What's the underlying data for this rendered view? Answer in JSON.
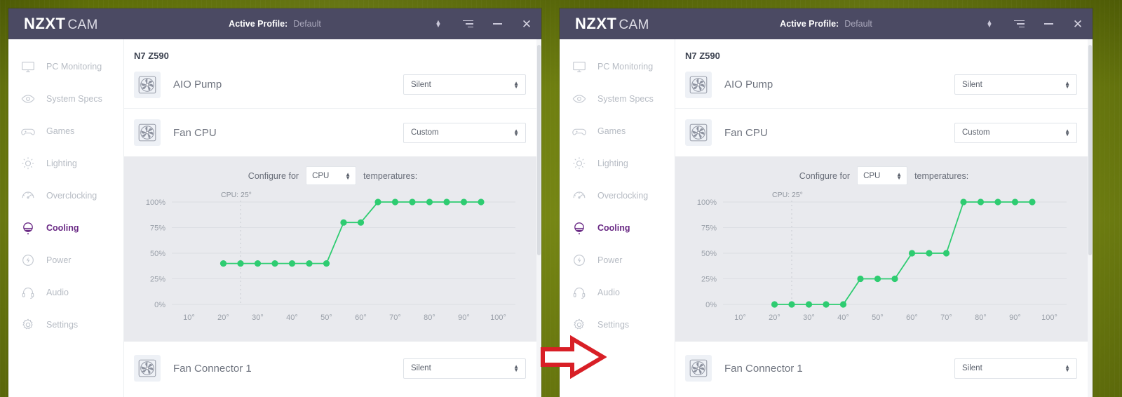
{
  "desktop": {
    "bg": "#76880f"
  },
  "window": {
    "titlebar": {
      "brand_bold": "NZXT",
      "brand_light": "CAM",
      "profile_label": "Active Profile:",
      "profile_value": "Default",
      "controls": [
        {
          "name": "profile-spinner-icon",
          "glyph": "spinner"
        },
        {
          "name": "menu-icon",
          "glyph": "hamburger"
        },
        {
          "name": "minimize-button",
          "glyph": "minimize"
        },
        {
          "name": "close-button",
          "glyph": "close"
        }
      ]
    },
    "sidebar": {
      "items": [
        {
          "label": "PC Monitoring",
          "icon": "monitor-icon",
          "active": false
        },
        {
          "label": "System Specs",
          "icon": "eye-icon",
          "active": false
        },
        {
          "label": "Games",
          "icon": "gamepad-icon",
          "active": false
        },
        {
          "label": "Lighting",
          "icon": "sun-icon",
          "active": false
        },
        {
          "label": "Overclocking",
          "icon": "speedometer-icon",
          "active": false
        },
        {
          "label": "Cooling",
          "icon": "cooling-icon",
          "active": true
        },
        {
          "label": "Power",
          "icon": "power-bolt-icon",
          "active": false
        },
        {
          "label": "Audio",
          "icon": "headset-icon",
          "active": false
        },
        {
          "label": "Settings",
          "icon": "gear-icon",
          "active": false
        }
      ]
    },
    "content": {
      "device_name": "N7 Z590",
      "rows": [
        {
          "label": "AIO Pump",
          "icon": "fan-icon",
          "mode": "Silent"
        },
        {
          "label": "Fan CPU",
          "icon": "fan-icon",
          "mode": "Custom"
        },
        {
          "label": "Fan Connector 1",
          "icon": "fan-icon",
          "mode": "Silent"
        }
      ],
      "configure": {
        "prefix": "Configure for",
        "source": "CPU",
        "suffix": "temperatures:"
      }
    }
  },
  "annotation": {
    "arrow": "right-arrow",
    "color": "#d81f26"
  },
  "chart_data": [
    {
      "type": "line",
      "panel": "left",
      "title": "",
      "xlabel": "",
      "ylabel": "",
      "xlim": [
        5,
        105
      ],
      "ylim": [
        0,
        100
      ],
      "grid": true,
      "legend": null,
      "line_color": "#2ecc71",
      "marker": "circle",
      "current_marker_label": "CPU: 25°",
      "current_temp": 25,
      "xtick_labels": [
        "10°",
        "20°",
        "30°",
        "40°",
        "50°",
        "60°",
        "70°",
        "80°",
        "90°",
        "100°"
      ],
      "xticks": [
        10,
        20,
        30,
        40,
        50,
        60,
        70,
        80,
        90,
        100
      ],
      "ytick_labels": [
        "0%",
        "25%",
        "50%",
        "75%",
        "100%"
      ],
      "yticks": [
        0,
        25,
        50,
        75,
        100
      ],
      "x": [
        20,
        25,
        30,
        35,
        40,
        45,
        50,
        55,
        60,
        65,
        70,
        75,
        80,
        85,
        90,
        95
      ],
      "values": [
        40,
        40,
        40,
        40,
        40,
        40,
        40,
        80,
        80,
        100,
        100,
        100,
        100,
        100,
        100,
        100
      ]
    },
    {
      "type": "line",
      "panel": "right",
      "title": "",
      "xlabel": "",
      "ylabel": "",
      "xlim": [
        5,
        105
      ],
      "ylim": [
        0,
        100
      ],
      "grid": true,
      "legend": null,
      "line_color": "#2ecc71",
      "marker": "circle",
      "current_marker_label": "CPU: 25°",
      "current_temp": 25,
      "xtick_labels": [
        "10°",
        "20°",
        "30°",
        "40°",
        "50°",
        "60°",
        "70°",
        "80°",
        "90°",
        "100°"
      ],
      "xticks": [
        10,
        20,
        30,
        40,
        50,
        60,
        70,
        80,
        90,
        100
      ],
      "ytick_labels": [
        "0%",
        "25%",
        "50%",
        "75%",
        "100%"
      ],
      "yticks": [
        0,
        25,
        50,
        75,
        100
      ],
      "x": [
        20,
        25,
        30,
        35,
        40,
        45,
        50,
        55,
        60,
        65,
        70,
        75,
        80,
        85,
        90,
        95
      ],
      "values": [
        0,
        0,
        0,
        0,
        0,
        25,
        25,
        25,
        50,
        50,
        50,
        100,
        100,
        100,
        100,
        100
      ]
    }
  ]
}
